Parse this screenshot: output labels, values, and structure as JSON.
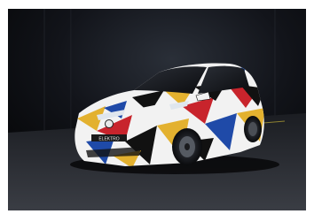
{
  "image": {
    "subject": "camouflaged-hatchback-car",
    "badge_text": "ELEKTRO",
    "colors": {
      "frame": "#ffffff",
      "studio_dark": "#0c0d10",
      "floor": "#2a2c31",
      "floor_marking": "#d8c23a",
      "camo_red": "#c8242c",
      "camo_yellow": "#e3b12f",
      "camo_blue": "#1f4aa8",
      "camo_black": "#111111",
      "camo_white": "#f2f2f2"
    }
  }
}
